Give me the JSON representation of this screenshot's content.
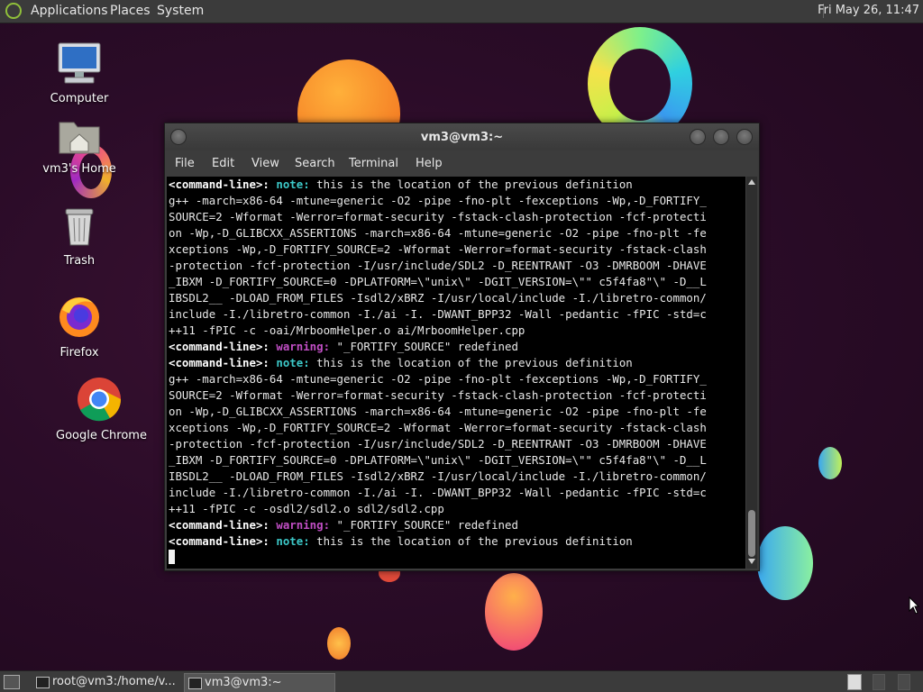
{
  "top_panel": {
    "menus": [
      "Applications",
      "Places",
      "System"
    ],
    "clock": "Fri May 26, 11:47"
  },
  "desktop_icons": [
    {
      "label": "Computer",
      "icon": "computer-icon"
    },
    {
      "label": "vm3's Home",
      "icon": "home-folder-icon"
    },
    {
      "label": "Trash",
      "icon": "trash-icon"
    },
    {
      "label": "Firefox",
      "icon": "firefox-icon"
    },
    {
      "label": "Google Chrome",
      "icon": "chrome-icon"
    }
  ],
  "terminal": {
    "title": "vm3@vm3:~",
    "menus": [
      "File",
      "Edit",
      "View",
      "Search",
      "Terminal",
      "Help"
    ],
    "lines": [
      [
        {
          "t": "<command-line>:",
          "c": "b"
        },
        {
          "t": " "
        },
        {
          "t": "note:",
          "c": "note"
        },
        {
          "t": " this is the location of the previous definition"
        }
      ],
      [
        {
          "t": "g++ -march=x86-64 -mtune=generic -O2 -pipe -fno-plt -fexceptions -Wp,-D_FORTIFY_"
        }
      ],
      [
        {
          "t": "SOURCE=2 -Wformat -Werror=format-security -fstack-clash-protection -fcf-protecti"
        }
      ],
      [
        {
          "t": "on -Wp,-D_GLIBCXX_ASSERTIONS -march=x86-64 -mtune=generic -O2 -pipe -fno-plt -fe"
        }
      ],
      [
        {
          "t": "xceptions -Wp,-D_FORTIFY_SOURCE=2 -Wformat -Werror=format-security -fstack-clash"
        }
      ],
      [
        {
          "t": "-protection -fcf-protection -I/usr/include/SDL2 -D_REENTRANT -O3 -DMRBOOM -DHAVE"
        }
      ],
      [
        {
          "t": "_IBXM -D_FORTIFY_SOURCE=0 -DPLATFORM=\\\"unix\\\" -DGIT_VERSION=\\\"\" c5f4fa8\"\\\" -D__L"
        }
      ],
      [
        {
          "t": "IBSDL2__ -DLOAD_FROM_FILES -Isdl2/xBRZ -I/usr/local/include -I./libretro-common/"
        }
      ],
      [
        {
          "t": "include -I./libretro-common -I./ai -I. -DWANT_BPP32 -Wall -pedantic -fPIC -std=c"
        }
      ],
      [
        {
          "t": "++11 -fPIC -c -oai/MrboomHelper.o ai/MrboomHelper.cpp"
        }
      ],
      [
        {
          "t": "<command-line>:",
          "c": "b"
        },
        {
          "t": " "
        },
        {
          "t": "warning:",
          "c": "warn"
        },
        {
          "t": " \"_FORTIFY_SOURCE\" redefined"
        }
      ],
      [
        {
          "t": "<command-line>:",
          "c": "b"
        },
        {
          "t": " "
        },
        {
          "t": "note:",
          "c": "note"
        },
        {
          "t": " this is the location of the previous definition"
        }
      ],
      [
        {
          "t": "g++ -march=x86-64 -mtune=generic -O2 -pipe -fno-plt -fexceptions -Wp,-D_FORTIFY_"
        }
      ],
      [
        {
          "t": "SOURCE=2 -Wformat -Werror=format-security -fstack-clash-protection -fcf-protecti"
        }
      ],
      [
        {
          "t": "on -Wp,-D_GLIBCXX_ASSERTIONS -march=x86-64 -mtune=generic -O2 -pipe -fno-plt -fe"
        }
      ],
      [
        {
          "t": "xceptions -Wp,-D_FORTIFY_SOURCE=2 -Wformat -Werror=format-security -fstack-clash"
        }
      ],
      [
        {
          "t": "-protection -fcf-protection -I/usr/include/SDL2 -D_REENTRANT -O3 -DMRBOOM -DHAVE"
        }
      ],
      [
        {
          "t": "_IBXM -D_FORTIFY_SOURCE=0 -DPLATFORM=\\\"unix\\\" -DGIT_VERSION=\\\"\" c5f4fa8\"\\\" -D__L"
        }
      ],
      [
        {
          "t": "IBSDL2__ -DLOAD_FROM_FILES -Isdl2/xBRZ -I/usr/local/include -I./libretro-common/"
        }
      ],
      [
        {
          "t": "include -I./libretro-common -I./ai -I. -DWANT_BPP32 -Wall -pedantic -fPIC -std=c"
        }
      ],
      [
        {
          "t": "++11 -fPIC -c -osdl2/sdl2.o sdl2/sdl2.cpp"
        }
      ],
      [
        {
          "t": "<command-line>:",
          "c": "b"
        },
        {
          "t": " "
        },
        {
          "t": "warning:",
          "c": "warn"
        },
        {
          "t": " \"_FORTIFY_SOURCE\" redefined"
        }
      ],
      [
        {
          "t": "<command-line>:",
          "c": "b"
        },
        {
          "t": " "
        },
        {
          "t": "note:",
          "c": "note"
        },
        {
          "t": " this is the location of the previous definition"
        }
      ]
    ]
  },
  "taskbar": {
    "tasks": [
      {
        "label": "root@vm3:/home/v...",
        "active": false
      },
      {
        "label": "vm3@vm3:~",
        "active": true
      }
    ]
  },
  "colors": {
    "panel": "#3b3b3b",
    "terminal_bg": "#000000",
    "note": "#3cc8c8",
    "warning": "#c04ec4"
  }
}
